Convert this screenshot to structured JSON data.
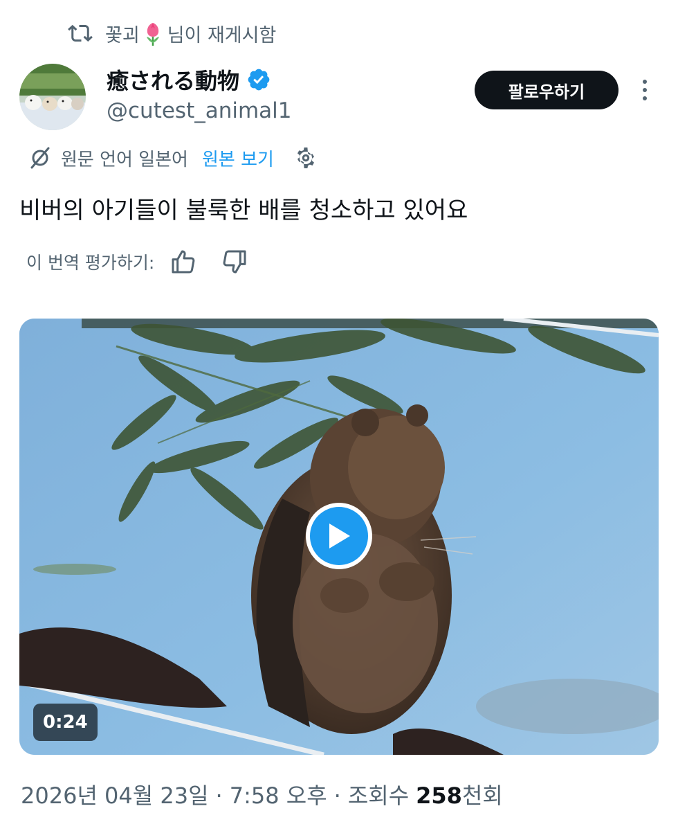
{
  "repost": {
    "icon": "repost-icon",
    "user_prefix": "꽃괴",
    "user_emoji": "tulip-emoji",
    "suffix": "님이 재게시함"
  },
  "author": {
    "display_name": "癒される動物",
    "handle": "@cutest_animal1",
    "verified": true,
    "avatar": "avatar-image"
  },
  "actions": {
    "follow_label": "팔로우하기",
    "more_icon": "more-vertical-icon"
  },
  "translation": {
    "icon": "translate-icon",
    "language_text": "원문 언어 일본어",
    "show_original_label": "원본 보기",
    "settings_icon": "gear-icon"
  },
  "tweet": {
    "text": "비버의 아기들이 불룩한 배를 청소하고 있어요"
  },
  "rating": {
    "label": "이 번역 평가하기:",
    "up_icon": "thumbs-up-icon",
    "down_icon": "thumbs-down-icon"
  },
  "media": {
    "duration": "0:24",
    "play_icon": "play-icon"
  },
  "meta": {
    "date": "2026년 04월 23일",
    "separator": "·",
    "time": "7:58 오후",
    "views_label": "조회수",
    "views_number": "258",
    "views_unit": "천회"
  },
  "colors": {
    "accent": "#1d9bf0",
    "text_primary": "#0f1419",
    "text_secondary": "#536471",
    "follow_button_bg": "#0f1419"
  }
}
